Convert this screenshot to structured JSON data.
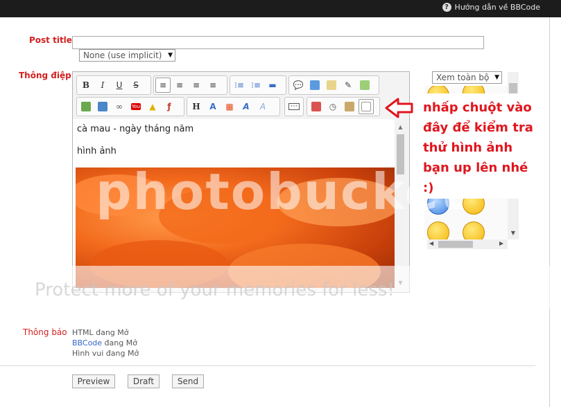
{
  "header": {
    "help_link": "Hướng dẫn về BBCode",
    "help_icon": "question-icon"
  },
  "form": {
    "post_title_label": "Post title",
    "post_title_value": "",
    "prefix_select": "None (use implicit)",
    "message_label": "Thông điệp",
    "notice_label": "Thông báo"
  },
  "toolbar": {
    "row1": [
      {
        "name": "bold",
        "glyph": "B"
      },
      {
        "name": "italic",
        "glyph": "I"
      },
      {
        "name": "underline",
        "glyph": "U"
      },
      {
        "name": "strikethrough",
        "glyph": "S"
      },
      {
        "name": "align-left",
        "glyph": "≡"
      },
      {
        "name": "align-center",
        "glyph": "≡"
      },
      {
        "name": "align-right",
        "glyph": "≡"
      },
      {
        "name": "justify",
        "glyph": "≡"
      },
      {
        "name": "bullet-list",
        "glyph": "⁝"
      },
      {
        "name": "numbered-list",
        "glyph": "⁝"
      },
      {
        "name": "horizontal-rule",
        "glyph": "▬"
      },
      {
        "name": "quote",
        "glyph": "💬"
      },
      {
        "name": "code",
        "glyph": "◧"
      },
      {
        "name": "insert-page",
        "glyph": "▤"
      },
      {
        "name": "edit-page",
        "glyph": "✎"
      },
      {
        "name": "add-page",
        "glyph": "▦"
      }
    ],
    "row2": [
      {
        "name": "insert-image",
        "glyph": "▣"
      },
      {
        "name": "image-upload",
        "glyph": "▣"
      },
      {
        "name": "link",
        "glyph": "∞"
      },
      {
        "name": "youtube",
        "glyph": "You"
      },
      {
        "name": "warning",
        "glyph": "▲"
      },
      {
        "name": "flash",
        "glyph": "ƒ"
      },
      {
        "name": "heading",
        "glyph": "H"
      },
      {
        "name": "font",
        "glyph": "A"
      },
      {
        "name": "color",
        "glyph": "▦"
      },
      {
        "name": "font-size",
        "glyph": "A"
      },
      {
        "name": "remove-format",
        "glyph": "A"
      },
      {
        "name": "more",
        "glyph": "⋯"
      },
      {
        "name": "calendar",
        "glyph": "▦"
      },
      {
        "name": "time",
        "glyph": "◷"
      },
      {
        "name": "paste",
        "glyph": "▤"
      },
      {
        "name": "preview-source",
        "glyph": "▯"
      }
    ]
  },
  "editor": {
    "line1": "cà mau - ngày tháng năm",
    "line2": "hình ảnh"
  },
  "smilies": {
    "select_label": "Xem toàn bộ"
  },
  "callout": {
    "text": "nhấp chuột vào đây để kiểm tra thử hình ảnh bạn up lên nhé :)"
  },
  "watermark": {
    "text": "photobucket",
    "band_text": "Protect more of your memories for less!"
  },
  "notices": {
    "html_label": "HTML đang Mở",
    "bbcode_link": "BBCode",
    "bbcode_state": " đang Mở",
    "smilies_label": "Hình vui đang Mở"
  },
  "buttons": {
    "preview": "Preview",
    "draft": "Draft",
    "send": "Send"
  }
}
